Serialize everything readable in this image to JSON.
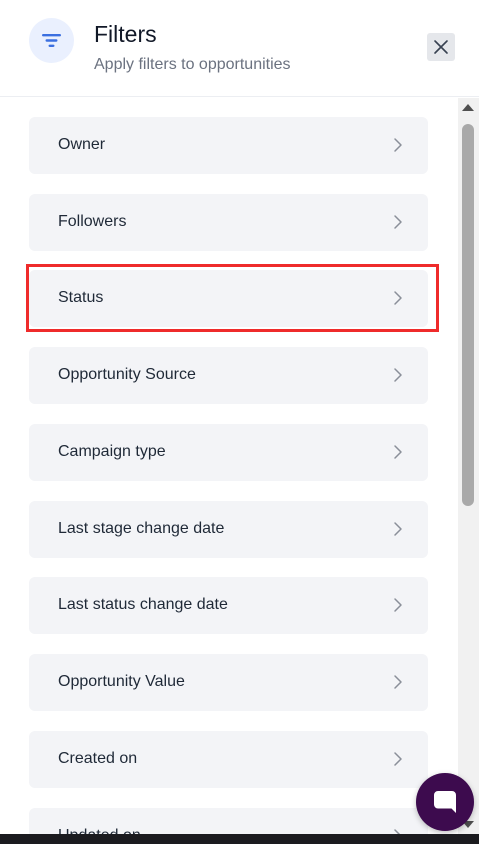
{
  "header": {
    "icon": "filter-icon",
    "title": "Filters",
    "subtitle": "Apply filters to opportunities",
    "close_icon": "close-icon"
  },
  "filters": [
    {
      "label": "Owner"
    },
    {
      "label": "Followers"
    },
    {
      "label": "Status",
      "highlighted": true
    },
    {
      "label": "Opportunity Source"
    },
    {
      "label": "Campaign type"
    },
    {
      "label": "Last stage change date"
    },
    {
      "label": "Last status change date"
    },
    {
      "label": "Opportunity Value"
    },
    {
      "label": "Created on"
    },
    {
      "label": "Updated on"
    }
  ],
  "chat_widget": {
    "icon": "chat-bubble-icon"
  },
  "colors": {
    "accent": "#3b6fe0",
    "highlight": "#ef2b2b",
    "item_background": "#f3f4f7",
    "chat_button": "#3d0b4e"
  }
}
